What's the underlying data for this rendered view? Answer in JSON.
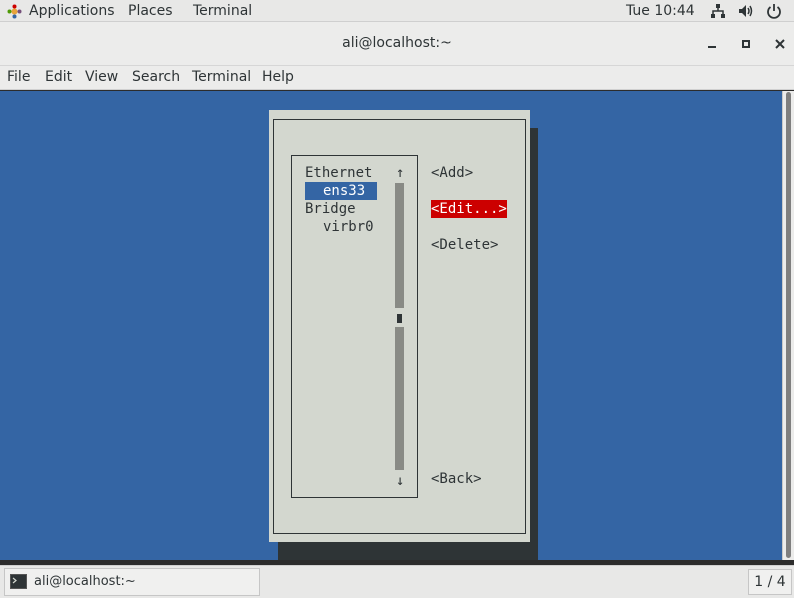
{
  "topbar": {
    "applications": "Applications",
    "places": "Places",
    "terminal": "Terminal",
    "clock": "Tue 10:44",
    "icons": [
      "network-icon",
      "volume-icon",
      "power-icon"
    ]
  },
  "window": {
    "title": "ali@localhost:~"
  },
  "menubar": {
    "items": [
      "File",
      "Edit",
      "View",
      "Search",
      "Terminal",
      "Help"
    ]
  },
  "nmtui": {
    "list": [
      {
        "label": "Ethernet",
        "indent": 0,
        "selected": false
      },
      {
        "label": "ens33",
        "indent": 1,
        "selected": true
      },
      {
        "label": "Bridge",
        "indent": 0,
        "selected": false
      },
      {
        "label": "virbr0",
        "indent": 1,
        "selected": false
      }
    ],
    "scroll_up": "↑",
    "scroll_down": "↓",
    "buttons": {
      "add": "<Add>",
      "edit": "<Edit...>",
      "delete": "<Delete>",
      "back": "<Back>"
    }
  },
  "taskbar": {
    "task_label": "ali@localhost:~",
    "workspace": "1 / 4"
  },
  "colors": {
    "terminal_bg": "#3465a4",
    "dialog_bg": "#d3d7cf",
    "selected_button": "#cc0000",
    "selected_list": "#3465a4"
  }
}
